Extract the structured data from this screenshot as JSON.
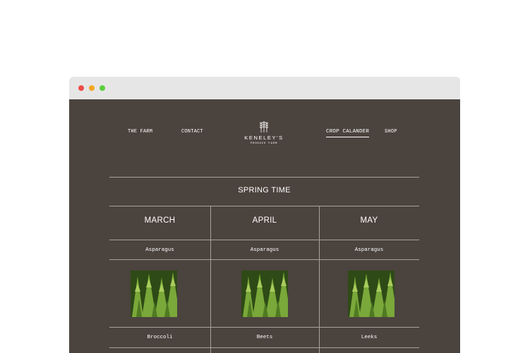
{
  "nav": {
    "left": [
      "THE FARM",
      "CONTACT"
    ],
    "right": [
      "CROP CALANDER",
      "SHOP"
    ],
    "active": "CROP CALANDER"
  },
  "logo": {
    "name": "KENELEY'S",
    "subtitle": "PRODUCE FARM"
  },
  "calendar": {
    "season": "SPRING TIME",
    "months": [
      {
        "name": "MARCH",
        "crops": [
          "Asparagus",
          "Broccoli"
        ]
      },
      {
        "name": "APRIL",
        "crops": [
          "Asparagus",
          "Beets"
        ]
      },
      {
        "name": "MAY",
        "crops": [
          "Asparagus",
          "Leeks"
        ]
      }
    ]
  },
  "colors": {
    "page_bg": "#4b433e",
    "titlebar": "#e6e6e6",
    "rule": "#a7a19c"
  }
}
